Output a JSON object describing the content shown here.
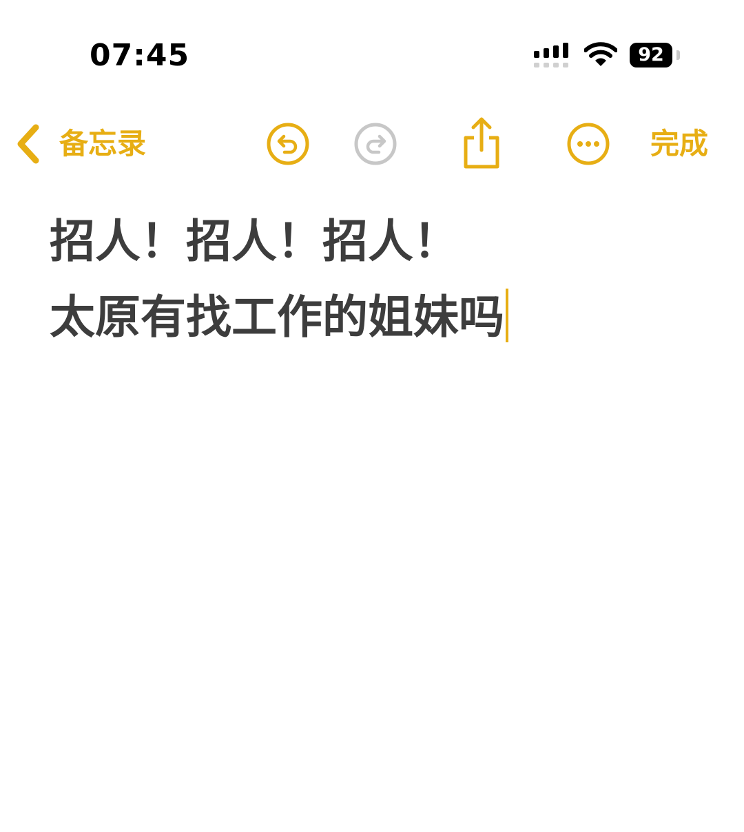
{
  "status_bar": {
    "time": "07:45",
    "battery_level": "92",
    "icons": [
      "cellular-signal-icon",
      "wifi-icon",
      "battery-icon"
    ]
  },
  "toolbar": {
    "back_label": "备忘录",
    "done_label": "完成",
    "icons": [
      "chevron-left-icon",
      "undo-icon",
      "redo-icon",
      "share-icon",
      "more-icon"
    ]
  },
  "note": {
    "lines": [
      "招人！招人！招人！",
      "太原有找工作的姐妹吗"
    ]
  },
  "colors": {
    "accent": "#E7AE14",
    "text": "#3d3d3d",
    "disabled": "#c7c7c7",
    "background": "#ffffff"
  }
}
